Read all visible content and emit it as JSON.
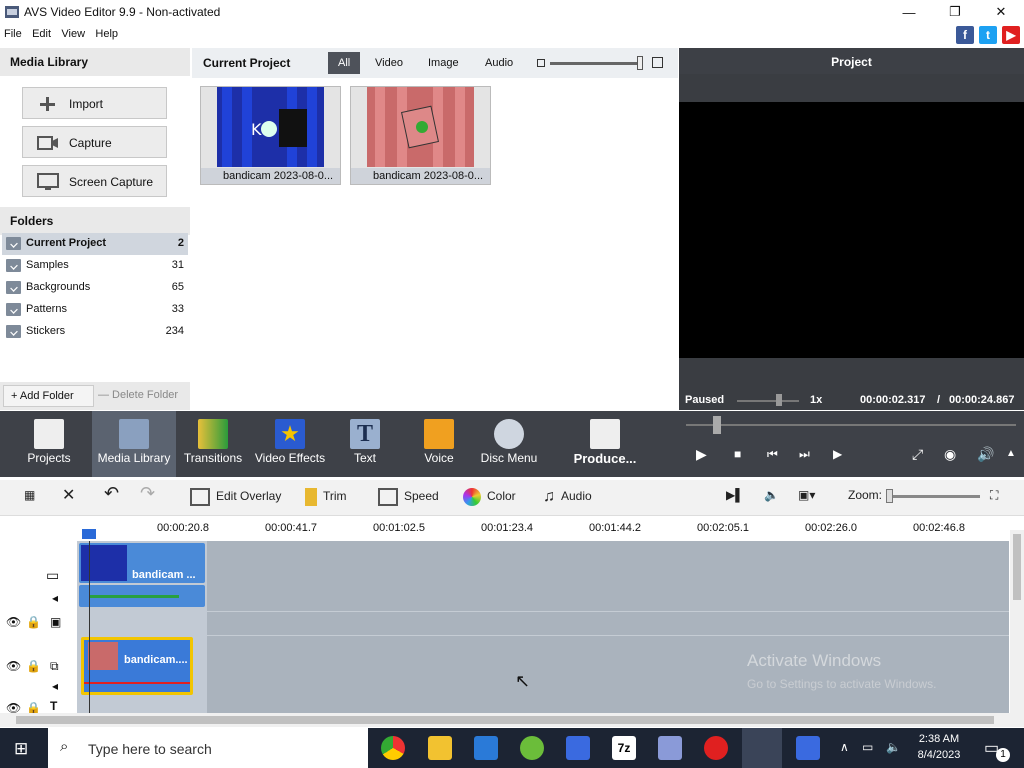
{
  "window": {
    "title": "AVS Video Editor 9.9 - Non-activated"
  },
  "menu": [
    "File",
    "Edit",
    "View",
    "Help"
  ],
  "media_library": {
    "header": "Media Library",
    "buttons": [
      {
        "label": "Import",
        "icon": "plus-icon"
      },
      {
        "label": "Capture",
        "icon": "camera-icon"
      },
      {
        "label": "Screen Capture",
        "icon": "monitor-icon"
      }
    ]
  },
  "folders": {
    "header": "Folders",
    "items": [
      {
        "name": "Current Project",
        "count": "2"
      },
      {
        "name": "Samples",
        "count": "31"
      },
      {
        "name": "Backgrounds",
        "count": "65"
      },
      {
        "name": "Patterns",
        "count": "33"
      },
      {
        "name": "Stickers",
        "count": "234"
      }
    ],
    "add": "+ Add Folder",
    "delete": "— Delete Folder"
  },
  "project": {
    "header": "Current Project",
    "filters": [
      "All",
      "Video",
      "Image",
      "Audio"
    ],
    "active_filter": "All",
    "files": [
      {
        "caption": "bandicam 2023-08-0..."
      },
      {
        "caption": "bandicam 2023-08-0..."
      }
    ]
  },
  "preview": {
    "header": "Project",
    "status": "Paused",
    "speed": "1x",
    "time_current": "00:00:02.317",
    "time_sep": "/",
    "time_total": "00:00:24.867"
  },
  "tools": [
    {
      "label": "Projects",
      "icon": "clapper-icon"
    },
    {
      "label": "Media Library",
      "icon": "film-icon"
    },
    {
      "label": "Transitions",
      "icon": "transitions-icon"
    },
    {
      "label": "Video Effects",
      "icon": "star-icon"
    },
    {
      "label": "Text",
      "icon": "text-icon"
    },
    {
      "label": "Voice",
      "icon": "microphone-icon"
    },
    {
      "label": "Disc Menu",
      "icon": "disc-icon"
    },
    {
      "label": "Produce...",
      "icon": "produce-icon"
    }
  ],
  "edit_toolbar": {
    "edit_overlay": "Edit Overlay",
    "trim": "Trim",
    "speed": "Speed",
    "color": "Color",
    "audio": "Audio",
    "zoom": "Zoom:"
  },
  "ruler": [
    "00:00:20.8",
    "00:00:41.7",
    "00:01:02.5",
    "00:01:23.4",
    "00:01:44.2",
    "00:02:05.1",
    "00:02:26.0",
    "00:02:46.8"
  ],
  "clips": {
    "video": "bandicam ...",
    "overlay": "bandicam...."
  },
  "watermark": {
    "line1": "Activate Windows",
    "line2": "Go to Settings to activate Windows."
  },
  "taskbar": {
    "search_placeholder": "Type here to search",
    "time": "2:38 AM",
    "date": "8/4/2023",
    "notifications": "1"
  },
  "colors": {
    "toolbar_bg": "#3e4148",
    "timeline_bg": "#aab3bd",
    "clip_blue": "#1a55c8",
    "clip_yellow": "#f2c500",
    "accent": "#3d4046"
  }
}
